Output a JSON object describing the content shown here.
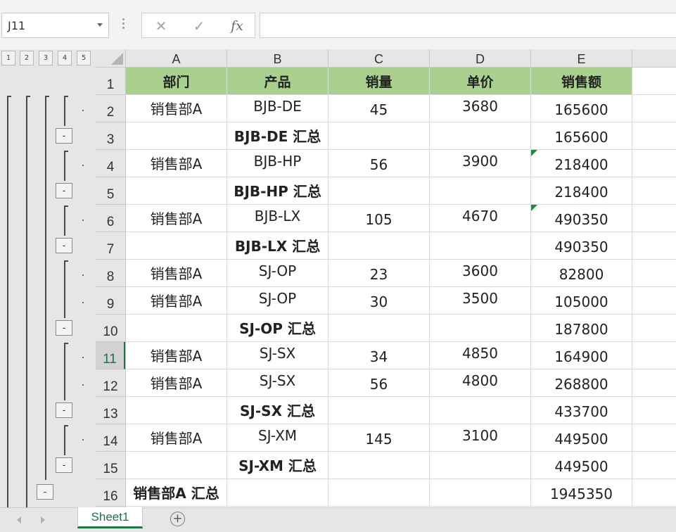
{
  "formula_bar": {
    "name_box": "J11",
    "cancel_icon": "✕",
    "enter_icon": "✓",
    "fx_label": "fx",
    "formula": ""
  },
  "outline": {
    "levels": [
      "1",
      "2",
      "3",
      "4",
      "5"
    ],
    "collapse_symbol": "-"
  },
  "columns": [
    "A",
    "B",
    "C",
    "D",
    "E"
  ],
  "rows": [
    {
      "num": "1",
      "cells": [
        "部门",
        "产品",
        "销量",
        "单价",
        "销售额"
      ],
      "type": "header"
    },
    {
      "num": "2",
      "cells": [
        "销售部A",
        "BJB-DE",
        "45",
        "3680",
        "165600"
      ],
      "type": "detail"
    },
    {
      "num": "3",
      "cells": [
        "",
        "BJB-DE 汇总",
        "",
        "",
        "165600"
      ],
      "type": "subtotal"
    },
    {
      "num": "4",
      "cells": [
        "销售部A",
        "BJB-HP",
        "56",
        "3900",
        "218400"
      ],
      "type": "detail",
      "flag_e": true
    },
    {
      "num": "5",
      "cells": [
        "",
        "BJB-HP 汇总",
        "",
        "",
        "218400"
      ],
      "type": "subtotal"
    },
    {
      "num": "6",
      "cells": [
        "销售部A",
        "BJB-LX",
        "105",
        "4670",
        "490350"
      ],
      "type": "detail",
      "flag_e": true
    },
    {
      "num": "7",
      "cells": [
        "",
        "BJB-LX 汇总",
        "",
        "",
        "490350"
      ],
      "type": "subtotal"
    },
    {
      "num": "8",
      "cells": [
        "销售部A",
        "SJ-OP",
        "23",
        "3600",
        "82800"
      ],
      "type": "detail"
    },
    {
      "num": "9",
      "cells": [
        "销售部A",
        "SJ-OP",
        "30",
        "3500",
        "105000"
      ],
      "type": "detail"
    },
    {
      "num": "10",
      "cells": [
        "",
        "SJ-OP 汇总",
        "",
        "",
        "187800"
      ],
      "type": "subtotal"
    },
    {
      "num": "11",
      "cells": [
        "销售部A",
        "SJ-SX",
        "34",
        "4850",
        "164900"
      ],
      "type": "detail",
      "active": true
    },
    {
      "num": "12",
      "cells": [
        "销售部A",
        "SJ-SX",
        "56",
        "4800",
        "268800"
      ],
      "type": "detail"
    },
    {
      "num": "13",
      "cells": [
        "",
        "SJ-SX 汇总",
        "",
        "",
        "433700"
      ],
      "type": "subtotal"
    },
    {
      "num": "14",
      "cells": [
        "销售部A",
        "SJ-XM",
        "145",
        "3100",
        "449500"
      ],
      "type": "detail"
    },
    {
      "num": "15",
      "cells": [
        "",
        "SJ-XM 汇总",
        "",
        "",
        "449500"
      ],
      "type": "subtotal"
    },
    {
      "num": "16",
      "cells": [
        "销售部A 汇总",
        "",
        "",
        "",
        "1945350"
      ],
      "type": "grand"
    }
  ],
  "sheets": {
    "active": "Sheet1",
    "add_symbol": "+"
  },
  "colors": {
    "header_fill": "#a9d08e",
    "accent": "#217346",
    "error_flag": "#1e8a3c"
  }
}
